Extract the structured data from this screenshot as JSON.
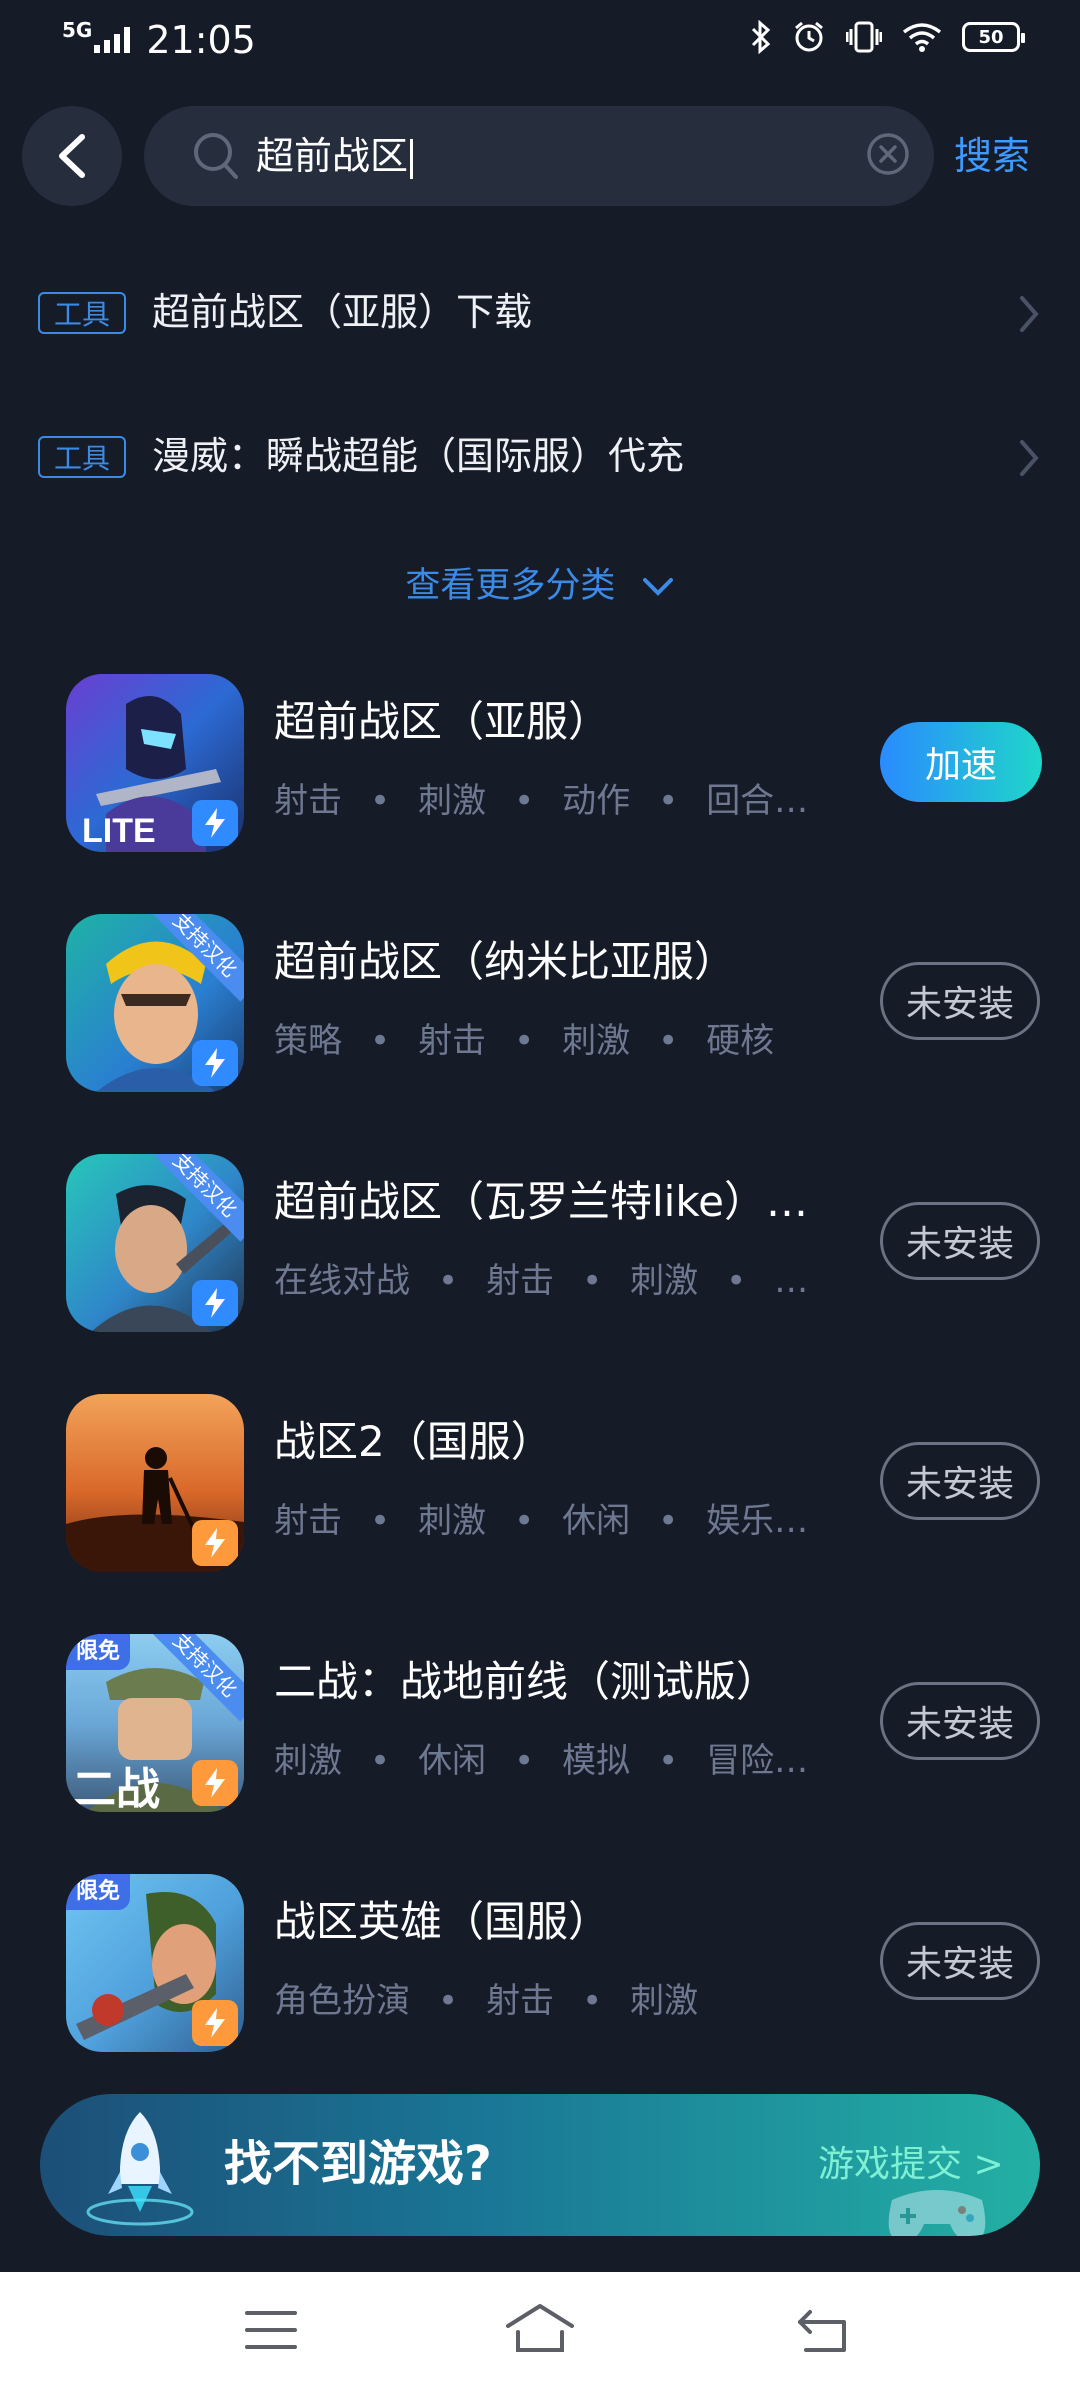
{
  "status": {
    "network": "5G",
    "time": "21:05",
    "battery": "50"
  },
  "search": {
    "query": "超前战区",
    "button": "搜索"
  },
  "tools": [
    {
      "tag": "工具",
      "text": "超前战区（亚服）下载"
    },
    {
      "tag": "工具",
      "text": "漫威：瞬战超能（国际服）代充"
    }
  ],
  "more": "查看更多分类",
  "games": [
    {
      "title": "超前战区（亚服）",
      "tags": [
        "射击",
        "刺激",
        "动作",
        "回合…"
      ],
      "action": "加速",
      "icon": "lite"
    },
    {
      "title": "超前战区（纳米比亚服）",
      "tags": [
        "策略",
        "射击",
        "刺激",
        "硬核"
      ],
      "action": "未安装",
      "icon": "hero",
      "corner": "支持汉化"
    },
    {
      "title": "超前战区（瓦罗兰特like）…",
      "tags": [
        "在线对战",
        "射击",
        "刺激",
        "…"
      ],
      "action": "未安装",
      "icon": "soldier",
      "corner": "支持汉化"
    },
    {
      "title": "战区2（国服）",
      "tags": [
        "射击",
        "刺激",
        "休闲",
        "娱乐…"
      ],
      "action": "未安装",
      "icon": "sunset"
    },
    {
      "title": "二战：战地前线（测试版）",
      "tags": [
        "刺激",
        "休闲",
        "模拟",
        "冒险…"
      ],
      "action": "未安装",
      "icon": "ww2",
      "corner": "支持汉化",
      "free": "限免",
      "icon_text": "二战"
    },
    {
      "title": "战区英雄（国服）",
      "tags": [
        "角色扮演",
        "射击",
        "刺激"
      ],
      "action": "未安装",
      "icon": "sniper",
      "free": "限免"
    }
  ],
  "banner": {
    "title": "找不到游戏?",
    "link": "游戏提交 >"
  },
  "colors": {
    "background": "#161b28",
    "accent": "#3b8ae6",
    "accel_start": "#2a8bff",
    "accel_end": "#1fd6c9"
  }
}
